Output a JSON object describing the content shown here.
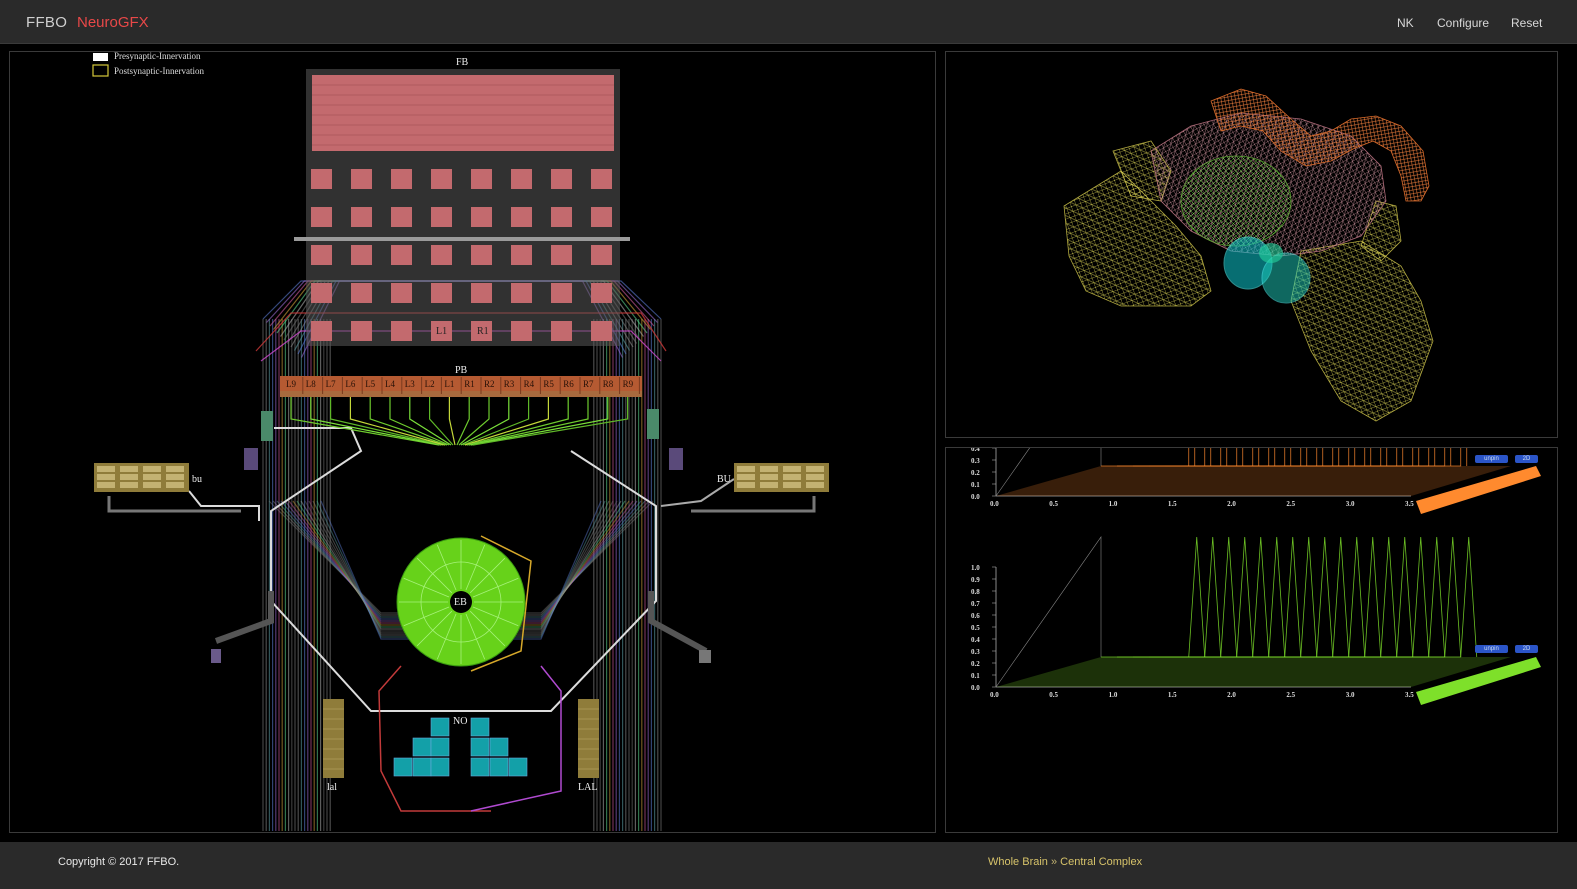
{
  "header": {
    "brand": "FFBO",
    "app_name": "NeuroGFX",
    "nav": [
      "NK",
      "Configure",
      "Reset"
    ]
  },
  "circuit": {
    "legend": [
      "Presynaptic-Innervation",
      "Postsynaptic-Innervation"
    ],
    "fb_label": "FB",
    "fb_glomeruli": [
      "L1",
      "R1"
    ],
    "pb_label": "PB",
    "pb_glomeruli": [
      "L9",
      "L8",
      "L7",
      "L6",
      "L5",
      "L4",
      "L3",
      "L2",
      "L1",
      "R1",
      "R2",
      "R3",
      "R4",
      "R5",
      "R6",
      "R7",
      "R8",
      "R9"
    ],
    "eb_label": "EB",
    "no_label": "NO",
    "bu_left": "bu",
    "bu_right": "BU",
    "lal_left": "lal",
    "lal_right": "LAL"
  },
  "plots": {
    "buttons": [
      "unpin",
      "2D"
    ],
    "y_ticks": [
      "1.0",
      "0.9",
      "0.8",
      "0.7",
      "0.6",
      "0.5",
      "0.4",
      "0.3",
      "0.2",
      "0.1",
      "0.0"
    ],
    "x_ticks": [
      "0.0",
      "0.5",
      "1.0",
      "1.5",
      "2.0",
      "2.5",
      "3.0",
      "3.5"
    ],
    "colors": {
      "top": "#ff8a2e",
      "bottom": "#7ee02a"
    }
  },
  "chart_data": [
    {
      "type": "line",
      "x": [
        0.0,
        0.5,
        1.0,
        1.5,
        2.0,
        2.5,
        3.0,
        3.5
      ],
      "ylim": [
        0,
        1.0
      ],
      "xlim": [
        0,
        3.5
      ],
      "series": [
        {
          "values": [
            0,
            0,
            1,
            1,
            1,
            1,
            1,
            1
          ]
        }
      ]
    },
    {
      "type": "line",
      "x": [
        0.0,
        0.5,
        1.0,
        1.5,
        2.0,
        2.5,
        3.0,
        3.5
      ],
      "ylim": [
        0,
        1.0
      ],
      "xlim": [
        0,
        3.5
      ],
      "series": [
        {
          "values": [
            0,
            0,
            1,
            1,
            1,
            1,
            1,
            1
          ]
        }
      ]
    }
  ],
  "footer": {
    "copyright": "Copyright © 2017 FFBO.",
    "breadcrumb": [
      "Whole Brain",
      "Central Complex"
    ],
    "separator": "»"
  }
}
